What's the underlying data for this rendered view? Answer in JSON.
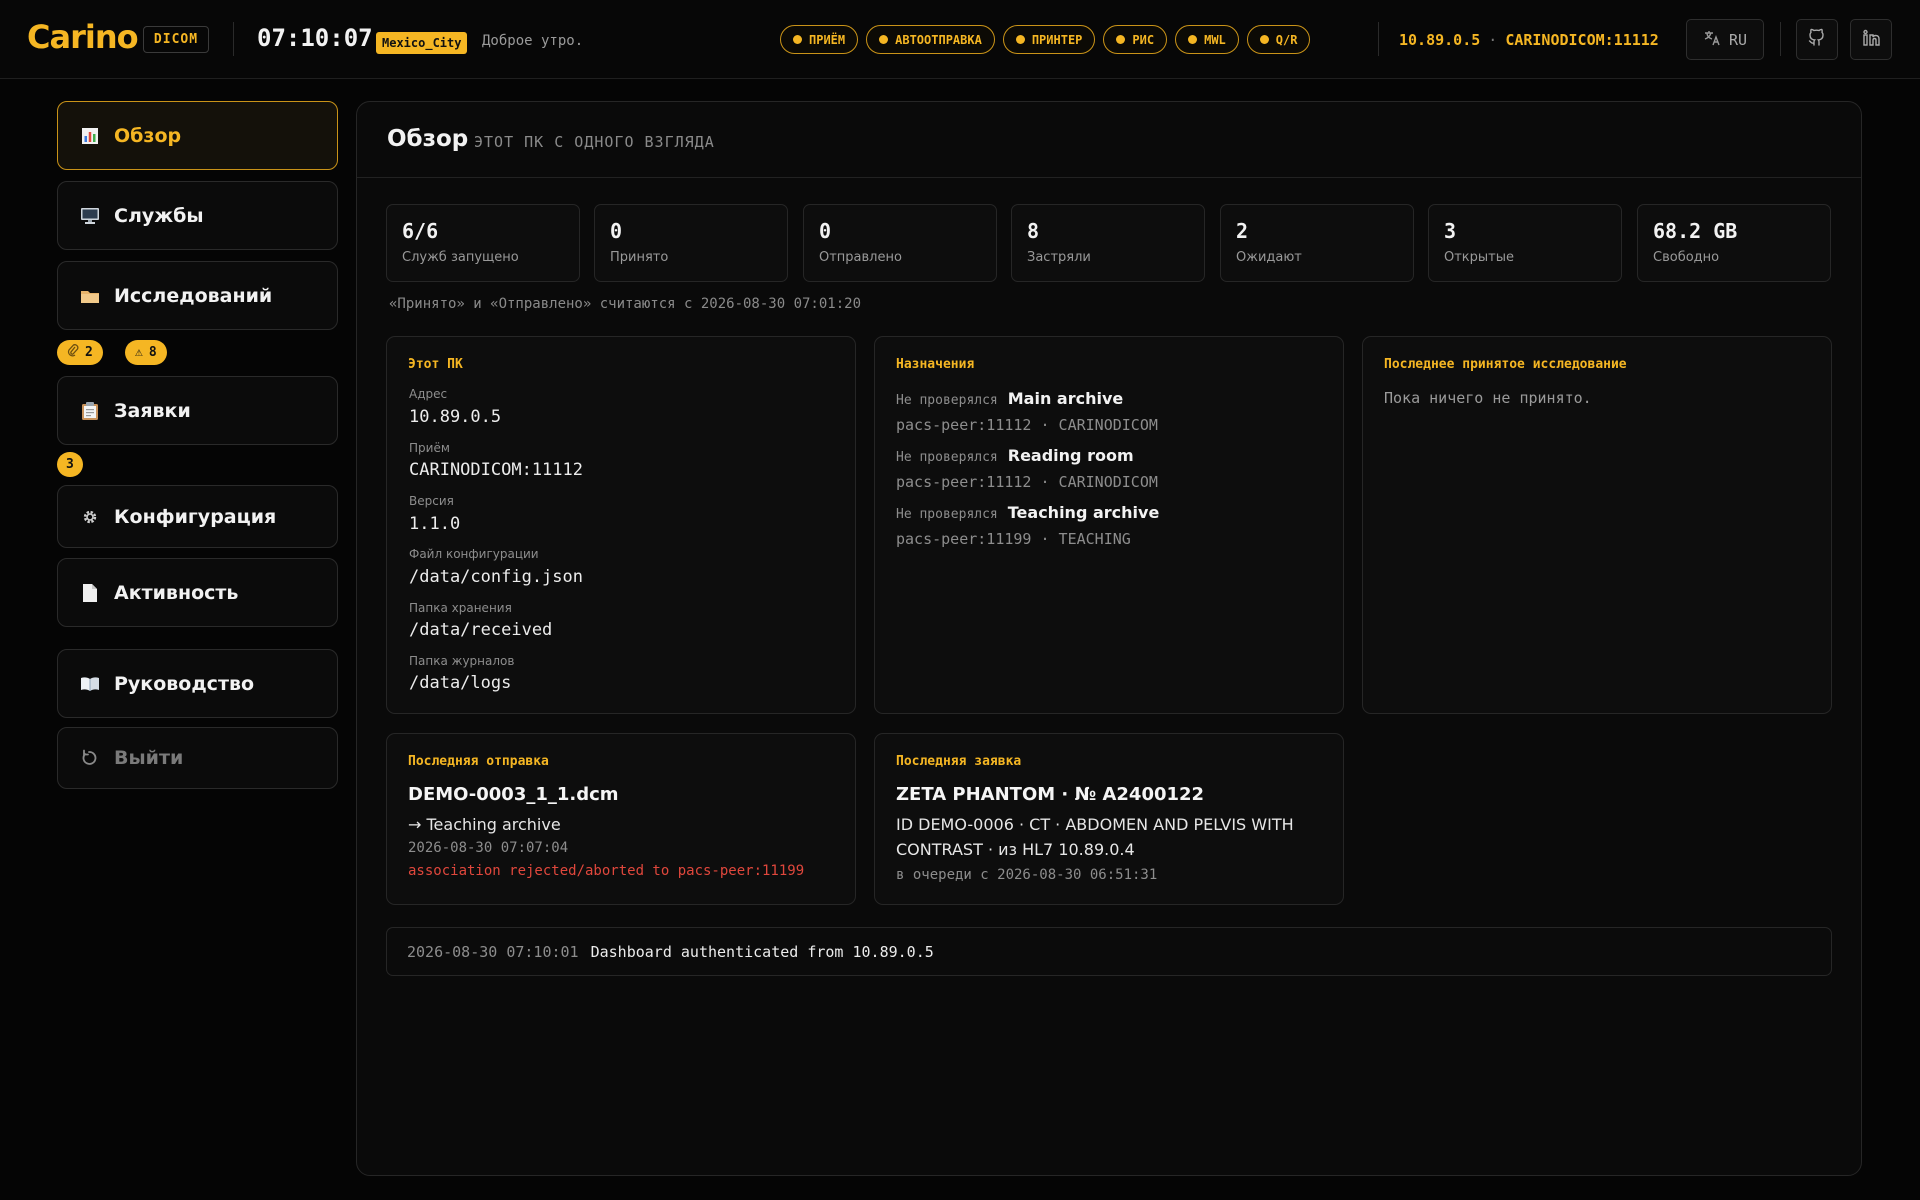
{
  "header": {
    "logo": "Carino",
    "badge": "DICOM",
    "clock": "07:10:07",
    "timezone": "Mexico_City",
    "greeting": "Доброе утро.",
    "services": [
      {
        "label": "ПРИЁМ",
        "status_color": "#f5b623"
      },
      {
        "label": "АВТООТПРАВКА",
        "status_color": "#f5b623"
      },
      {
        "label": "ПРИНТЕР",
        "status_color": "#f5b623"
      },
      {
        "label": "РИС",
        "status_color": "#f5b623"
      },
      {
        "label": "MWL",
        "status_color": "#f5b623"
      },
      {
        "label": "Q/R",
        "status_color": "#f5b623"
      }
    ],
    "host_ip": "10.89.0.5",
    "host_sep": "·",
    "ae_port": "CARINODICOM:11112",
    "language": "RU",
    "icons": {
      "language": "translate-icon",
      "github": "github-icon",
      "linkedin": "linkedin-icon"
    }
  },
  "sidebar": {
    "items": [
      {
        "label": "Обзор",
        "icon": "chart-icon"
      },
      {
        "label": "Службы",
        "icon": "monitor-icon"
      },
      {
        "label": "Исследований",
        "icon": "folder-icon"
      },
      {
        "label": "Заявки",
        "icon": "clipboard-icon"
      },
      {
        "label": "Конфигурация",
        "icon": "gear-icon"
      },
      {
        "label": "Активность",
        "icon": "document-icon"
      },
      {
        "label": "Руководство",
        "icon": "book-icon"
      },
      {
        "label": "Выйти",
        "icon": "logout-icon"
      }
    ],
    "studies_badges": [
      {
        "icon": "paperclip-icon",
        "count": "2"
      },
      {
        "icon": "warning-icon",
        "symbol": "⚠",
        "count": "8"
      }
    ],
    "orders_badge": "3"
  },
  "main": {
    "title": "Обзор",
    "subtitle": "ЭТОТ ПК С ОДНОГО ВЗГЛЯДА",
    "stats": [
      {
        "value": "6/6",
        "label": "Служб запущено"
      },
      {
        "value": "0",
        "label": "Принято"
      },
      {
        "value": "0",
        "label": "Отправлено"
      },
      {
        "value": "8",
        "label": "Застряли"
      },
      {
        "value": "2",
        "label": "Ожидают"
      },
      {
        "value": "3",
        "label": "Открытые"
      },
      {
        "value": "68.2 GB",
        "label": "Свободно"
      }
    ],
    "counters_note": "«Принято» и «Отправлено» считаются с 2026-08-30 07:01:20",
    "this_pc": {
      "title": "Этот ПК",
      "fields": [
        {
          "label": "Адрес",
          "value": "10.89.0.5"
        },
        {
          "label": "Приём",
          "value": "CARINODICOM:11112"
        },
        {
          "label": "Версия",
          "value": "1.1.0"
        },
        {
          "label": "Файл конфигурации",
          "value": "/data/config.json"
        },
        {
          "label": "Папка хранения",
          "value": "/data/received"
        },
        {
          "label": "Папка журналов",
          "value": "/data/logs"
        }
      ]
    },
    "destinations": {
      "title": "Назначения",
      "items": [
        {
          "status": "Не проверялся",
          "name": "Main archive",
          "peer": "pacs-peer:11112 · CARINODICOM"
        },
        {
          "status": "Не проверялся",
          "name": "Reading room",
          "peer": "pacs-peer:11112 · CARINODICOM"
        },
        {
          "status": "Не проверялся",
          "name": "Teaching archive",
          "peer": "pacs-peer:11199 · TEACHING"
        }
      ]
    },
    "last_received": {
      "title": "Последнее принятое исследование",
      "empty": "Пока ничего не принято."
    },
    "last_send": {
      "title": "Последняя отправка",
      "file": "DEMO-0003_1_1.dcm",
      "target": "→ Teaching archive",
      "time": "2026-08-30 07:07:04",
      "error": "association rejected/aborted to pacs-peer:11199"
    },
    "last_order": {
      "title": "Последняя заявка",
      "patient": "ZETA PHANTOM · № A2400122",
      "details_line1": "ID DEMO-0006 · CT · ABDOMEN AND PELVIS WITH",
      "details_line2": "CONTRAST · из HL7 10.89.0.4",
      "queued": "в очереди с 2026-08-30 06:51:31"
    },
    "log": {
      "time": "2026-08-30 07:10:01",
      "message": "Dashboard authenticated from 10.89.0.5"
    }
  }
}
